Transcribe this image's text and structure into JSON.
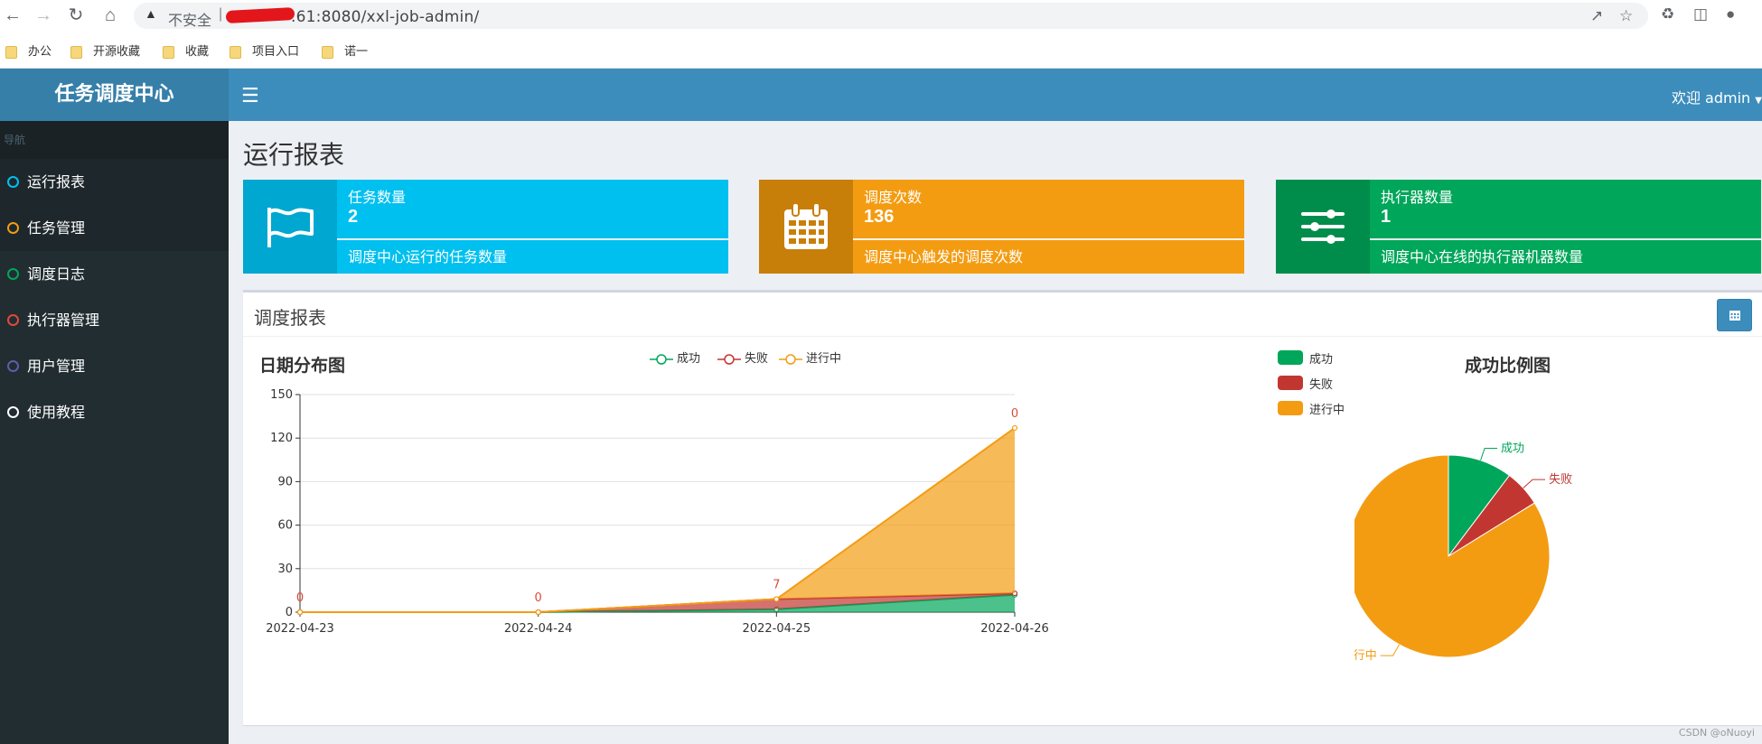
{
  "browser": {
    "insecure_label": "不安全",
    "url": ".61:8080/xxl-job-admin/",
    "bookmarks": [
      "办公",
      "开源收藏",
      "收藏",
      "项目入口",
      "诺一"
    ]
  },
  "app": {
    "brand": "任务调度中心",
    "welcome": "欢迎 admin",
    "nav_header": "导航",
    "nav_items": [
      {
        "label": "运行报表",
        "color": "#00c0ef",
        "active": true
      },
      {
        "label": "任务管理",
        "color": "#f39c12",
        "active": true
      },
      {
        "label": "调度日志",
        "color": "#00a65a",
        "active": false
      },
      {
        "label": "执行器管理",
        "color": "#dd4b39",
        "active": false
      },
      {
        "label": "用户管理",
        "color": "#605ca8",
        "active": false
      },
      {
        "label": "使用教程",
        "color": "#ffffff",
        "active": false
      }
    ]
  },
  "page": {
    "title": "运行报表"
  },
  "infoboxes": [
    {
      "label": "任务数量",
      "value": "2",
      "desc": "调度中心运行的任务数量",
      "icon": "flag-icon",
      "color": "#00c0ef",
      "icon_bg": "#00a7d0"
    },
    {
      "label": "调度次数",
      "value": "136",
      "desc": "调度中心触发的调度次数",
      "icon": "calendar-icon",
      "color": "#f39c12",
      "icon_bg": "#c87f0a"
    },
    {
      "label": "执行器数量",
      "value": "1",
      "desc": "调度中心在线的执行器机器数量",
      "icon": "sliders-icon",
      "color": "#00a65a",
      "icon_bg": "#008d4c"
    }
  ],
  "report": {
    "title": "调度报表",
    "calendar_button_icon": "calendar-icon"
  },
  "chart_data": [
    {
      "type": "area",
      "title": "日期分布图",
      "x": [
        "2022-04-23",
        "2022-04-24",
        "2022-04-25",
        "2022-04-26"
      ],
      "series": [
        {
          "name": "成功",
          "values": [
            0,
            0,
            2,
            12
          ],
          "color": "#00a65a"
        },
        {
          "name": "失败",
          "values": [
            0,
            0,
            7,
            1
          ],
          "color": "#c23632"
        },
        {
          "name": "进行中",
          "values": [
            0,
            0,
            0,
            114
          ],
          "color": "#f39c12"
        }
      ],
      "stacked": true,
      "data_labels": [
        "0",
        "0",
        "7",
        "0"
      ],
      "ylim": [
        0,
        150
      ],
      "yticks": [
        0,
        30,
        60,
        90,
        120,
        150
      ],
      "grid": true,
      "legend": "top-center"
    },
    {
      "type": "pie",
      "title": "成功比例图",
      "labels": [
        "成功",
        "失败",
        "进行中"
      ],
      "values": [
        14,
        8,
        114
      ],
      "colors": [
        "#00a65a",
        "#c23632",
        "#f39c12"
      ],
      "legend": "top-left"
    }
  ],
  "watermark": "CSDN @oNuoyi"
}
